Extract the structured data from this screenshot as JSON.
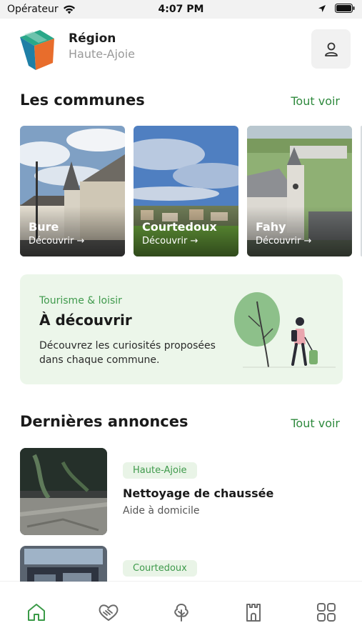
{
  "status": {
    "carrier": "Opérateur",
    "time": "4:07 PM"
  },
  "header": {
    "title": "Région",
    "subtitle": "Haute-Ajoie",
    "logo_icon": "region-logo-cube",
    "profile_icon": "user-icon"
  },
  "communes": {
    "section_title": "Les communes",
    "see_all": "Tout voir",
    "items": [
      {
        "name": "Bure",
        "cta": "Découvrir →"
      },
      {
        "name": "Courtedoux",
        "cta": "Découvrir →"
      },
      {
        "name": "Fahy",
        "cta": "Découvrir →"
      }
    ]
  },
  "promo": {
    "category": "Tourisme & loisir",
    "title": "À découvrir",
    "description": "Découvrez les curiosités proposées dans chaque commune."
  },
  "announcements": {
    "section_title": "Dernières annonces",
    "see_all": "Tout voir",
    "items": [
      {
        "badge": "Haute-Ajoie",
        "title": "Nettoyage de chaussée",
        "subtitle": "Aide à domicile"
      },
      {
        "badge": "Courtedoux",
        "title": "",
        "subtitle": ""
      }
    ]
  },
  "tabs": [
    {
      "icon": "home-icon",
      "active": true
    },
    {
      "icon": "handshake-heart-icon",
      "active": false
    },
    {
      "icon": "tree-icon",
      "active": false
    },
    {
      "icon": "castle-tower-icon",
      "active": false
    },
    {
      "icon": "grid-menu-icon",
      "active": false
    }
  ],
  "colors": {
    "accent": "#2f8a3e",
    "promo_bg": "#ecf6ea",
    "badge_bg": "#e9f4e7",
    "active_tab": "#3a9a47",
    "inactive_tab": "#6b6b6b"
  }
}
